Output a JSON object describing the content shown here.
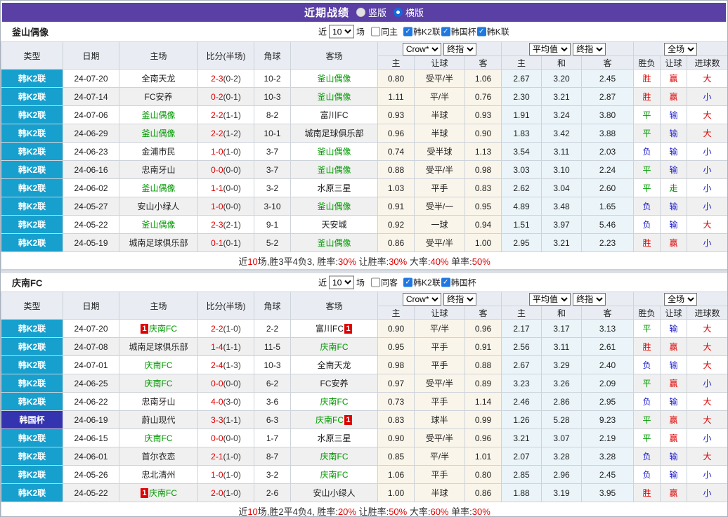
{
  "title_bar": {
    "title": "近期战绩",
    "radio_options": [
      {
        "label": "竖版",
        "selected": false
      },
      {
        "label": "横版",
        "selected": true
      }
    ]
  },
  "table_headers": {
    "cols": [
      "类型",
      "日期",
      "主场",
      "比分(半场)",
      "角球",
      "客场"
    ],
    "sub": [
      "主",
      "让球",
      "客",
      "主",
      "和",
      "客",
      "胜负",
      "让球",
      "进球数"
    ],
    "controls": {
      "odds_source": "Crow*",
      "final_1": "终指",
      "avg": "平均值",
      "final_2": "终指",
      "scope": "全场"
    }
  },
  "filter_labels": {
    "near": "近",
    "games_suffix": "场"
  },
  "sections": [
    {
      "team": "釜山偶像",
      "filter": {
        "games_value": "10",
        "same_venue_label": "同主",
        "same_venue_checked": false,
        "leagues": [
          {
            "label": "韩K2联",
            "checked": true
          },
          {
            "label": "韩国杯",
            "checked": true
          },
          {
            "label": "韩K联",
            "checked": true
          }
        ]
      },
      "rows": [
        {
          "type": "韩K2联",
          "type_style": "k2",
          "date": "24-07-20",
          "home": "全南天龙",
          "home_focus": false,
          "home_card": "",
          "home_card_pos": "",
          "score": "2-3",
          "half": "(0-2)",
          "corner": "10-2",
          "away": "釜山偶像",
          "away_focus": true,
          "away_card": "",
          "away_card_pos": "",
          "w1": "0.80",
          "handicap": "受平/半",
          "w2": "1.06",
          "avg_h": "2.67",
          "avg_d": "3.20",
          "avg_a": "2.45",
          "result": "胜",
          "asian": "赢",
          "goals": "大"
        },
        {
          "type": "韩K2联",
          "type_style": "k2",
          "date": "24-07-14",
          "home": "FC安养",
          "home_focus": false,
          "home_card": "",
          "home_card_pos": "",
          "score": "0-2",
          "half": "(0-1)",
          "corner": "10-3",
          "away": "釜山偶像",
          "away_focus": true,
          "away_card": "",
          "away_card_pos": "",
          "w1": "1.11",
          "handicap": "平/半",
          "w2": "0.76",
          "avg_h": "2.30",
          "avg_d": "3.21",
          "avg_a": "2.87",
          "result": "胜",
          "asian": "赢",
          "goals": "小"
        },
        {
          "type": "韩K2联",
          "type_style": "k2",
          "date": "24-07-06",
          "home": "釜山偶像",
          "home_focus": true,
          "home_card": "",
          "home_card_pos": "",
          "score": "2-2",
          "half": "(1-1)",
          "corner": "8-2",
          "away": "富川FC",
          "away_focus": false,
          "away_card": "",
          "away_card_pos": "",
          "w1": "0.93",
          "handicap": "半球",
          "w2": "0.93",
          "avg_h": "1.91",
          "avg_d": "3.24",
          "avg_a": "3.80",
          "result": "平",
          "asian": "输",
          "goals": "大"
        },
        {
          "type": "韩K2联",
          "type_style": "k2",
          "date": "24-06-29",
          "home": "釜山偶像",
          "home_focus": true,
          "home_card": "",
          "home_card_pos": "",
          "score": "2-2",
          "half": "(1-2)",
          "corner": "10-1",
          "away": "城南足球俱乐部",
          "away_focus": false,
          "away_card": "",
          "away_card_pos": "",
          "w1": "0.96",
          "handicap": "半球",
          "w2": "0.90",
          "avg_h": "1.83",
          "avg_d": "3.42",
          "avg_a": "3.88",
          "result": "平",
          "asian": "输",
          "goals": "大"
        },
        {
          "type": "韩K2联",
          "type_style": "k2",
          "date": "24-06-23",
          "home": "金浦市民",
          "home_focus": false,
          "home_card": "",
          "home_card_pos": "",
          "score": "1-0",
          "half": "(1-0)",
          "corner": "3-7",
          "away": "釜山偶像",
          "away_focus": true,
          "away_card": "",
          "away_card_pos": "",
          "w1": "0.74",
          "handicap": "受半球",
          "w2": "1.13",
          "avg_h": "3.54",
          "avg_d": "3.11",
          "avg_a": "2.03",
          "result": "负",
          "asian": "输",
          "goals": "小"
        },
        {
          "type": "韩K2联",
          "type_style": "k2",
          "date": "24-06-16",
          "home": "忠南牙山",
          "home_focus": false,
          "home_card": "",
          "home_card_pos": "",
          "score": "0-0",
          "half": "(0-0)",
          "corner": "3-7",
          "away": "釜山偶像",
          "away_focus": true,
          "away_card": "",
          "away_card_pos": "",
          "w1": "0.88",
          "handicap": "受平/半",
          "w2": "0.98",
          "avg_h": "3.03",
          "avg_d": "3.10",
          "avg_a": "2.24",
          "result": "平",
          "asian": "输",
          "goals": "小"
        },
        {
          "type": "韩K2联",
          "type_style": "k2",
          "date": "24-06-02",
          "home": "釜山偶像",
          "home_focus": true,
          "home_card": "",
          "home_card_pos": "",
          "score": "1-1",
          "half": "(0-0)",
          "corner": "3-2",
          "away": "水原三星",
          "away_focus": false,
          "away_card": "",
          "away_card_pos": "",
          "w1": "1.03",
          "handicap": "平手",
          "w2": "0.83",
          "avg_h": "2.62",
          "avg_d": "3.04",
          "avg_a": "2.60",
          "result": "平",
          "asian": "走",
          "goals": "小"
        },
        {
          "type": "韩K2联",
          "type_style": "k2",
          "date": "24-05-27",
          "home": "安山小绿人",
          "home_focus": false,
          "home_card": "",
          "home_card_pos": "",
          "score": "1-0",
          "half": "(0-0)",
          "corner": "3-10",
          "away": "釜山偶像",
          "away_focus": true,
          "away_card": "",
          "away_card_pos": "",
          "w1": "0.91",
          "handicap": "受半/一",
          "w2": "0.95",
          "avg_h": "4.89",
          "avg_d": "3.48",
          "avg_a": "1.65",
          "result": "负",
          "asian": "输",
          "goals": "小"
        },
        {
          "type": "韩K2联",
          "type_style": "k2",
          "date": "24-05-22",
          "home": "釜山偶像",
          "home_focus": true,
          "home_card": "",
          "home_card_pos": "",
          "score": "2-3",
          "half": "(2-1)",
          "corner": "9-1",
          "away": "天安城",
          "away_focus": false,
          "away_card": "",
          "away_card_pos": "",
          "w1": "0.92",
          "handicap": "一球",
          "w2": "0.94",
          "avg_h": "1.51",
          "avg_d": "3.97",
          "avg_a": "5.46",
          "result": "负",
          "asian": "输",
          "goals": "大"
        },
        {
          "type": "韩K2联",
          "type_style": "k2",
          "date": "24-05-19",
          "home": "城南足球俱乐部",
          "home_focus": false,
          "home_card": "",
          "home_card_pos": "",
          "score": "0-1",
          "half": "(0-1)",
          "corner": "5-2",
          "away": "釜山偶像",
          "away_focus": true,
          "away_card": "",
          "away_card_pos": "",
          "w1": "0.86",
          "handicap": "受平/半",
          "w2": "1.00",
          "avg_h": "2.95",
          "avg_d": "3.21",
          "avg_a": "2.23",
          "result": "胜",
          "asian": "赢",
          "goals": "小"
        }
      ],
      "summary": [
        {
          "text": "近",
          "red": false
        },
        {
          "text": "10",
          "red": true
        },
        {
          "text": "场,胜3平4负3, 胜率:",
          "red": false
        },
        {
          "text": "30%",
          "red": true
        },
        {
          "text": " 让胜率:",
          "red": false
        },
        {
          "text": "30%",
          "red": true
        },
        {
          "text": " 大率:",
          "red": false
        },
        {
          "text": "40%",
          "red": true
        },
        {
          "text": " 单率:",
          "red": false
        },
        {
          "text": "50%",
          "red": true
        }
      ]
    },
    {
      "team": "庆南FC",
      "filter": {
        "games_value": "10",
        "same_venue_label": "同客",
        "same_venue_checked": false,
        "leagues": [
          {
            "label": "韩K2联",
            "checked": true
          },
          {
            "label": "韩国杯",
            "checked": true
          }
        ]
      },
      "rows": [
        {
          "type": "韩K2联",
          "type_style": "k2",
          "date": "24-07-20",
          "home": "庆南FC",
          "home_focus": true,
          "home_card": "1",
          "home_card_pos": "left",
          "score": "2-2",
          "half": "(1-0)",
          "corner": "2-2",
          "away": "富川FC",
          "away_focus": false,
          "away_card": "1",
          "away_card_pos": "right",
          "w1": "0.90",
          "handicap": "平/半",
          "w2": "0.96",
          "avg_h": "2.17",
          "avg_d": "3.17",
          "avg_a": "3.13",
          "result": "平",
          "asian": "输",
          "goals": "大"
        },
        {
          "type": "韩K2联",
          "type_style": "k2",
          "date": "24-07-08",
          "home": "城南足球俱乐部",
          "home_focus": false,
          "home_card": "",
          "home_card_pos": "",
          "score": "1-4",
          "half": "(1-1)",
          "corner": "11-5",
          "away": "庆南FC",
          "away_focus": true,
          "away_card": "",
          "away_card_pos": "",
          "w1": "0.95",
          "handicap": "平手",
          "w2": "0.91",
          "avg_h": "2.56",
          "avg_d": "3.11",
          "avg_a": "2.61",
          "result": "胜",
          "asian": "赢",
          "goals": "大"
        },
        {
          "type": "韩K2联",
          "type_style": "k2",
          "date": "24-07-01",
          "home": "庆南FC",
          "home_focus": true,
          "home_card": "",
          "home_card_pos": "",
          "score": "2-4",
          "half": "(1-3)",
          "corner": "10-3",
          "away": "全南天龙",
          "away_focus": false,
          "away_card": "",
          "away_card_pos": "",
          "w1": "0.98",
          "handicap": "平手",
          "w2": "0.88",
          "avg_h": "2.67",
          "avg_d": "3.29",
          "avg_a": "2.40",
          "result": "负",
          "asian": "输",
          "goals": "大"
        },
        {
          "type": "韩K2联",
          "type_style": "k2",
          "date": "24-06-25",
          "home": "庆南FC",
          "home_focus": true,
          "home_card": "",
          "home_card_pos": "",
          "score": "0-0",
          "half": "(0-0)",
          "corner": "6-2",
          "away": "FC安养",
          "away_focus": false,
          "away_card": "",
          "away_card_pos": "",
          "w1": "0.97",
          "handicap": "受平/半",
          "w2": "0.89",
          "avg_h": "3.23",
          "avg_d": "3.26",
          "avg_a": "2.09",
          "result": "平",
          "asian": "赢",
          "goals": "小"
        },
        {
          "type": "韩K2联",
          "type_style": "k2",
          "date": "24-06-22",
          "home": "忠南牙山",
          "home_focus": false,
          "home_card": "",
          "home_card_pos": "",
          "score": "4-0",
          "half": "(3-0)",
          "corner": "3-6",
          "away": "庆南FC",
          "away_focus": true,
          "away_card": "",
          "away_card_pos": "",
          "w1": "0.73",
          "handicap": "平手",
          "w2": "1.14",
          "avg_h": "2.46",
          "avg_d": "2.86",
          "avg_a": "2.95",
          "result": "负",
          "asian": "输",
          "goals": "大"
        },
        {
          "type": "韩国杯",
          "type_style": "cup",
          "date": "24-06-19",
          "home": "蔚山现代",
          "home_focus": false,
          "home_card": "",
          "home_card_pos": "",
          "score": "3-3",
          "half": "(1-1)",
          "corner": "6-3",
          "away": "庆南FC",
          "away_focus": true,
          "away_card": "1",
          "away_card_pos": "right",
          "w1": "0.83",
          "handicap": "球半",
          "w2": "0.99",
          "avg_h": "1.26",
          "avg_d": "5.28",
          "avg_a": "9.23",
          "result": "平",
          "asian": "赢",
          "goals": "大"
        },
        {
          "type": "韩K2联",
          "type_style": "k2",
          "date": "24-06-15",
          "home": "庆南FC",
          "home_focus": true,
          "home_card": "",
          "home_card_pos": "",
          "score": "0-0",
          "half": "(0-0)",
          "corner": "1-7",
          "away": "水原三星",
          "away_focus": false,
          "away_card": "",
          "away_card_pos": "",
          "w1": "0.90",
          "handicap": "受平/半",
          "w2": "0.96",
          "avg_h": "3.21",
          "avg_d": "3.07",
          "avg_a": "2.19",
          "result": "平",
          "asian": "赢",
          "goals": "小"
        },
        {
          "type": "韩K2联",
          "type_style": "k2",
          "date": "24-06-01",
          "home": "首尔衣恋",
          "home_focus": false,
          "home_card": "",
          "home_card_pos": "",
          "score": "2-1",
          "half": "(1-0)",
          "corner": "8-7",
          "away": "庆南FC",
          "away_focus": true,
          "away_card": "",
          "away_card_pos": "",
          "w1": "0.85",
          "handicap": "平/半",
          "w2": "1.01",
          "avg_h": "2.07",
          "avg_d": "3.28",
          "avg_a": "3.28",
          "result": "负",
          "asian": "输",
          "goals": "大"
        },
        {
          "type": "韩K2联",
          "type_style": "k2",
          "date": "24-05-26",
          "home": "忠北清州",
          "home_focus": false,
          "home_card": "",
          "home_card_pos": "",
          "score": "1-0",
          "half": "(1-0)",
          "corner": "3-2",
          "away": "庆南FC",
          "away_focus": true,
          "away_card": "",
          "away_card_pos": "",
          "w1": "1.06",
          "handicap": "平手",
          "w2": "0.80",
          "avg_h": "2.85",
          "avg_d": "2.96",
          "avg_a": "2.45",
          "result": "负",
          "asian": "输",
          "goals": "小"
        },
        {
          "type": "韩K2联",
          "type_style": "k2",
          "date": "24-05-22",
          "home": "庆南FC",
          "home_focus": true,
          "home_card": "1",
          "home_card_pos": "left",
          "score": "2-0",
          "half": "(1-0)",
          "corner": "2-6",
          "away": "安山小绿人",
          "away_focus": false,
          "away_card": "",
          "away_card_pos": "",
          "w1": "1.00",
          "handicap": "半球",
          "w2": "0.86",
          "avg_h": "1.88",
          "avg_d": "3.19",
          "avg_a": "3.95",
          "result": "胜",
          "asian": "赢",
          "goals": "小"
        }
      ],
      "summary": [
        {
          "text": "近",
          "red": false
        },
        {
          "text": "10",
          "red": true
        },
        {
          "text": "场,胜2平4负4, 胜率:",
          "red": false
        },
        {
          "text": "20%",
          "red": true
        },
        {
          "text": " 让胜率:",
          "red": false
        },
        {
          "text": "50%",
          "red": true
        },
        {
          "text": " 大率:",
          "red": false
        },
        {
          "text": "60%",
          "red": true
        },
        {
          "text": " 单率:",
          "red": false
        },
        {
          "text": "30%",
          "red": true
        }
      ]
    }
  ],
  "colors": {
    "title_bar": "#5A40A5",
    "league_k2_badge": "#17A0CD",
    "cup_badge": "#3434B0",
    "focus_team_green": "#009900",
    "win_red": "#E00000",
    "lose_blue": "#2222CC",
    "crow_odds_bg": "#FAF5EA",
    "avg_odds_bg": "#EAF4F9"
  }
}
